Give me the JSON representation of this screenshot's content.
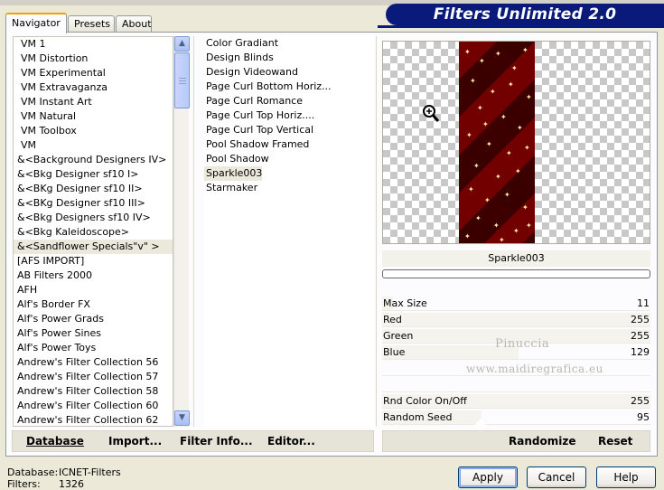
{
  "header": {
    "title": "Filters Unlimited 2.0"
  },
  "tabs": [
    {
      "label": "Navigator",
      "active": true
    },
    {
      "label": "Presets",
      "active": false
    },
    {
      "label": "About",
      "active": false
    }
  ],
  "categories": [
    "VM 1",
    "VM Distortion",
    "VM Experimental",
    "VM Extravaganza",
    "VM Instant Art",
    "VM Natural",
    "VM Toolbox",
    "VM",
    "&<Background Designers IV>",
    "&<Bkg Designer sf10 I>",
    "&<BKg Designer sf10 II>",
    "&<BKg Designer sf10 III>",
    "&<Bkg Designers sf10 IV>",
    "&<Bkg Kaleidoscope>",
    "&<Sandflower Specials\"v\" >",
    "[AFS IMPORT]",
    "AB Filters 2000",
    "AFH",
    "Alf's Border FX",
    "Alf's Power Grads",
    "Alf's Power Sines",
    "Alf's Power Toys",
    "Andrew's Filter Collection 56",
    "Andrew's Filter Collection 57",
    "Andrew's Filter Collection 58",
    "Andrew's Filter Collection 60",
    "Andrew's Filter Collection 62"
  ],
  "selected_category_index": 14,
  "filters": [
    "Color Gradiant",
    "Design Blinds",
    "Design Videowand",
    "Page Curl Bottom Horiz...",
    "Page Curl Romance",
    "Page Curl Top Horiz....",
    "Page Curl Top Vertical",
    "Pool Shadow Framed",
    "Pool Shadow",
    "Sparkle003",
    "Starmaker"
  ],
  "selected_filter_index": 9,
  "preview": {
    "filter_name": "Sparkle003",
    "progress": 0
  },
  "params": [
    {
      "label": "Max Size",
      "value": "11",
      "fraction": 0.04
    },
    {
      "label": "Red",
      "value": "255",
      "fraction": 1.0
    },
    {
      "label": "Green",
      "value": "255",
      "fraction": 1.0
    },
    {
      "label": "Blue",
      "value": "129",
      "fraction": 0.51
    },
    {
      "label": "",
      "value": "",
      "fraction": 0
    },
    {
      "label": "",
      "value": "",
      "fraction": 0
    },
    {
      "label": "Rnd Color On/Off",
      "value": "255",
      "fraction": 1.0
    },
    {
      "label": "Random Seed",
      "value": "95",
      "fraction": 0.37
    }
  ],
  "watermark": {
    "line1": "Pinuccia",
    "line2": "www.maidiregrafica.eu"
  },
  "toolbar": {
    "database_label": "Database",
    "import_label": "Import...",
    "filter_info_label": "Filter Info...",
    "editor_label": "Editor...",
    "randomize_label": "Randomize",
    "reset_label": "Reset"
  },
  "status": {
    "database_key": "Database:",
    "database_value": "ICNET-Filters",
    "filters_key": "Filters:",
    "filters_value": "1326"
  },
  "buttons": {
    "apply": "Apply",
    "cancel": "Cancel",
    "help": "Help"
  }
}
